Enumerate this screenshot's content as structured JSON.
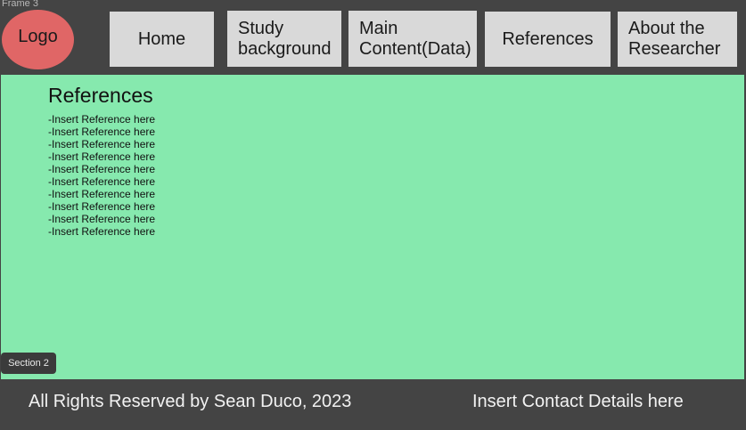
{
  "frame": {
    "label": "Frame 3"
  },
  "header": {
    "logo_text": "Logo",
    "nav": [
      "Home",
      "Study\nbackground",
      "Main\nContent(Data)",
      "References",
      "About the\nResearcher"
    ]
  },
  "section": {
    "title": "References",
    "references": [
      "-Insert Reference here",
      "-Insert Reference here",
      "-Insert Reference here",
      "-Insert Reference here",
      "-Insert Reference here",
      "-Insert Reference here",
      "-Insert Reference here",
      "-Insert Reference here",
      "-Insert Reference here",
      "-Insert Reference here"
    ],
    "badge": "Section 2"
  },
  "footer": {
    "rights": "All Rights Reserved by Sean Duco, 2023",
    "contact": "Insert Contact Details here"
  },
  "colors": {
    "background": "#444444",
    "logo": "#e06666",
    "nav_button": "#d9d9d9",
    "section": "#86e9ae"
  }
}
